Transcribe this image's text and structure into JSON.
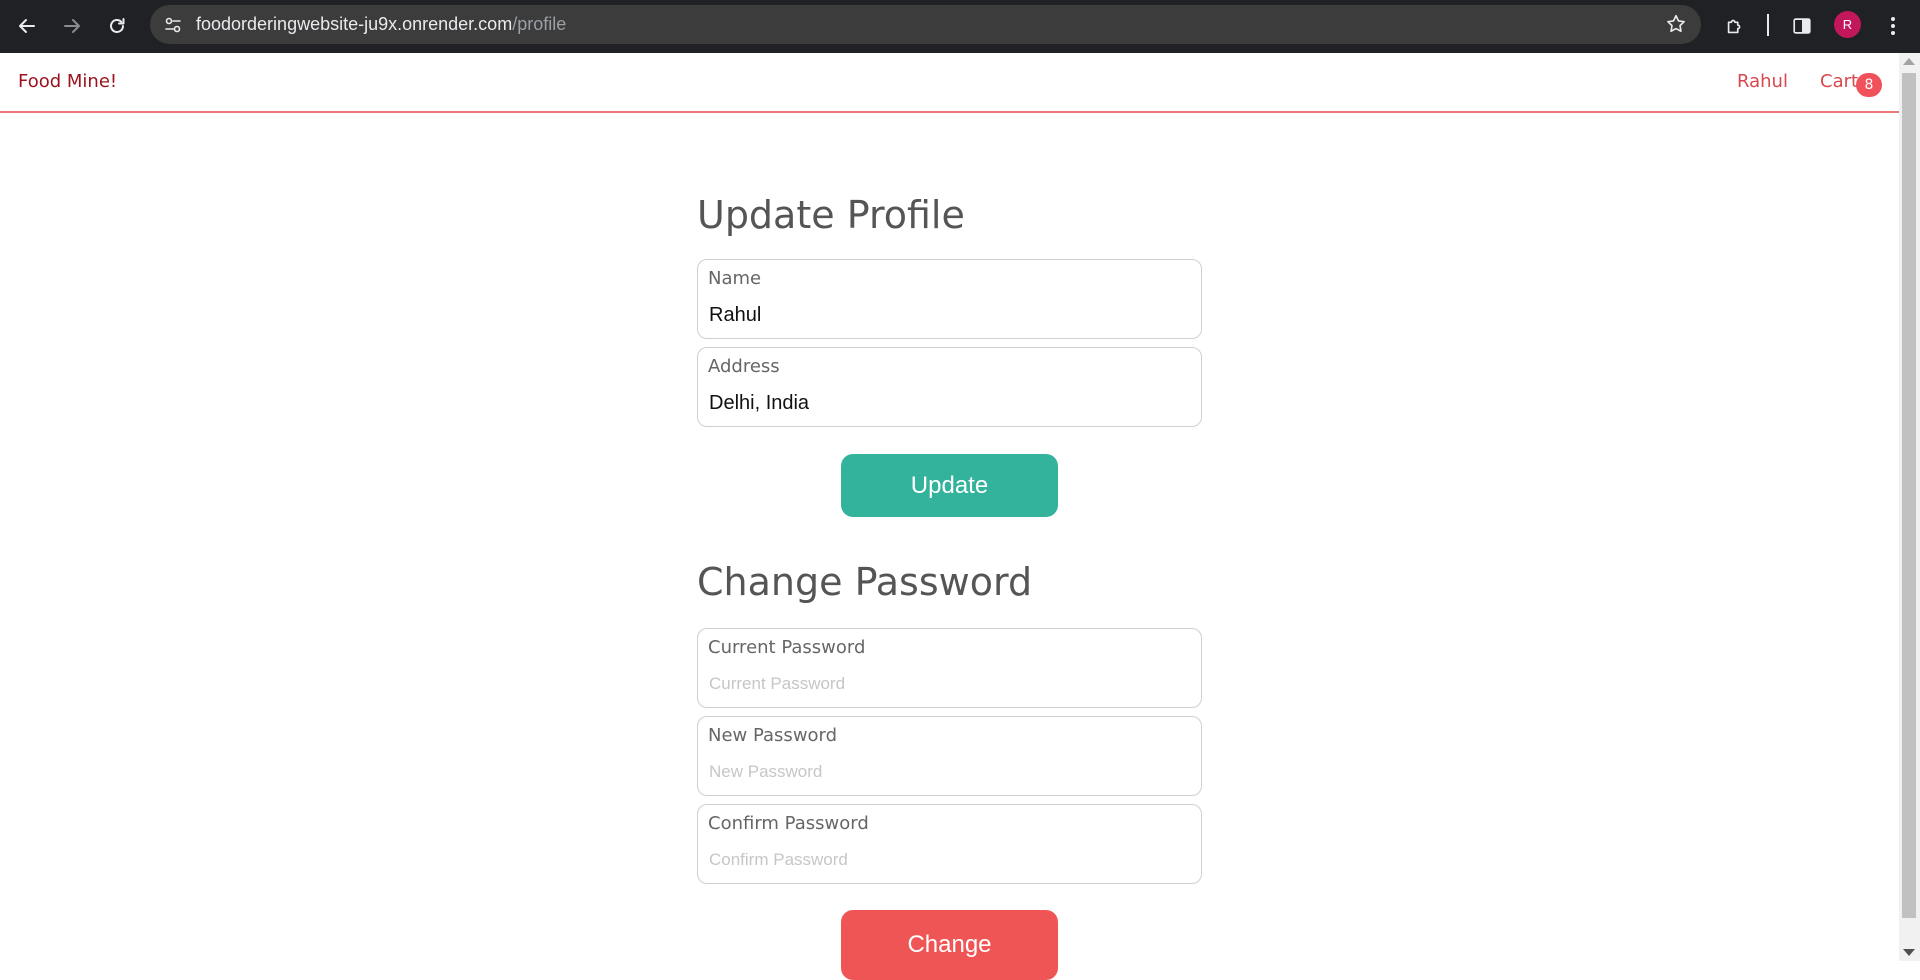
{
  "browser": {
    "url_host": "foodorderingwebsite-ju9x.onrender.com",
    "url_path": "/profile",
    "profile_initial": "R",
    "icons": [
      "back-arrow-icon",
      "forward-arrow-icon",
      "reload-icon",
      "site-settings-icon",
      "bookmark-star-icon",
      "extensions-icon",
      "side-panel-icon",
      "more-vert-icon"
    ]
  },
  "header": {
    "brand": "Food Mine!",
    "user_name": "Rahul",
    "cart_label": "Cart",
    "cart_count": "8",
    "brand_color": "#9b111e",
    "accent_color": "#d9474f"
  },
  "profile_form": {
    "title": "Update Profile",
    "name_label": "Name",
    "name_value": "Rahul",
    "address_label": "Address",
    "address_value": "Delhi, India",
    "submit_label": "Update",
    "submit_color": "#33b29c"
  },
  "password_form": {
    "title": "Change Password",
    "current_label": "Current Password",
    "current_placeholder": "Current Password",
    "new_label": "New Password",
    "new_placeholder": "New Password",
    "confirm_label": "Confirm Password",
    "confirm_placeholder": "Confirm Password",
    "submit_label": "Change",
    "submit_color": "#ef5555"
  }
}
